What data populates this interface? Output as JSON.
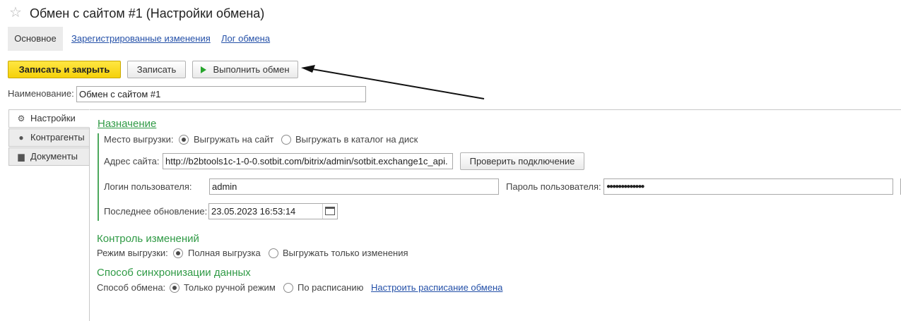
{
  "header": {
    "title": "Обмен с сайтом #1 (Настройки обмена)",
    "favorite_icon": "star-icon"
  },
  "nav": {
    "main": "Основное",
    "registered": "Зарегистрированные изменения",
    "log": "Лог обмена"
  },
  "toolbar": {
    "save_close": "Записать и закрыть",
    "save": "Записать",
    "run": "Выполнить обмен"
  },
  "name": {
    "label": "Наименование:",
    "value": "Обмен с сайтом #1"
  },
  "sidetabs": [
    {
      "label": "Настройки",
      "icon": "gear-icon"
    },
    {
      "label": "Контрагенты",
      "icon": "people-icon"
    },
    {
      "label": "Документы",
      "icon": "document-icon"
    }
  ],
  "destination": {
    "title": "Назначение",
    "place_label": "Место выгрузки:",
    "opt_site": "Выгружать на сайт",
    "opt_disk": "Выгружать в каталог на диск",
    "selected": "site",
    "address_label": "Адрес сайта:",
    "address_value": "http://b2btools1c-1-0-0.sotbit.com/bitrix/admin/sotbit.exchange1c_api.",
    "check_button": "Проверить подключение",
    "login_label": "Логин пользователя:",
    "login_value": "admin",
    "password_label": "Пароль пользователя:",
    "password_value": "●●●●●●●●●●●●●",
    "updated_label": "Последнее обновление:",
    "updated_value": "23.05.2023 16:53:14"
  },
  "changes": {
    "title": "Контроль изменений",
    "mode_label": "Режим выгрузки:",
    "opt_full": "Полная выгрузка",
    "opt_changes": "Выгружать только изменения",
    "selected": "full"
  },
  "sync": {
    "title": "Способ синхронизации данных",
    "method_label": "Способ обмена:",
    "opt_manual": "Только ручной режим",
    "opt_schedule": "По расписанию",
    "schedule_link": "Настроить расписание обмена",
    "selected": "manual"
  },
  "colors": {
    "accent_yellow": "#f5d109",
    "section_green": "#2f9a45",
    "link_blue": "#2450a8"
  }
}
